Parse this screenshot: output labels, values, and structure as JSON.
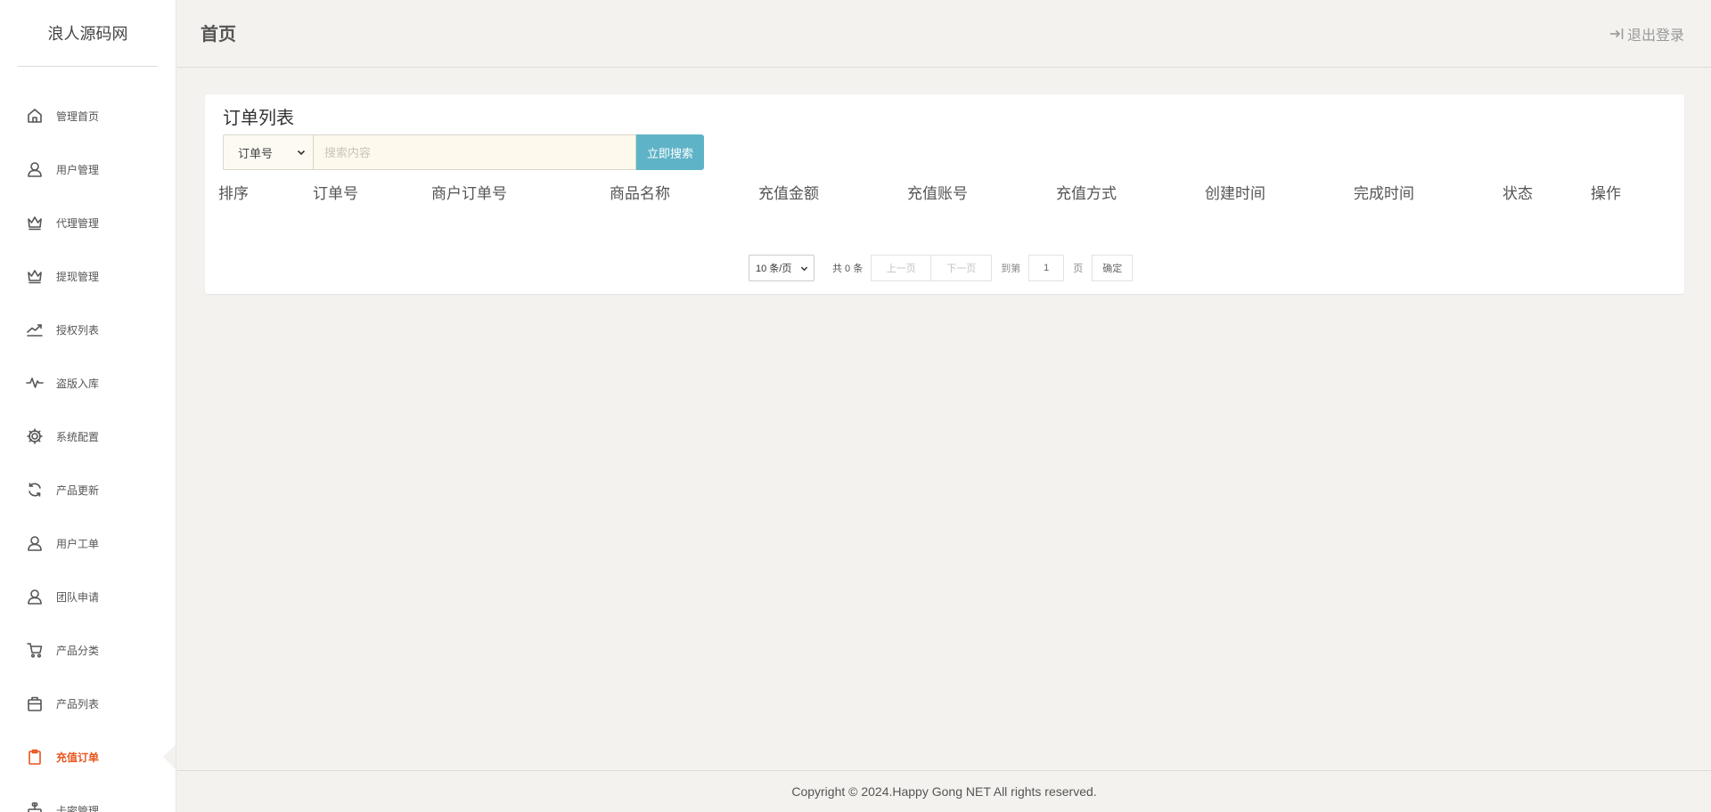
{
  "app": {
    "logo_text": "浪人源码网"
  },
  "sidebar": {
    "items": [
      {
        "label": "管理首页",
        "icon": "home-icon"
      },
      {
        "label": "用户管理",
        "icon": "user-icon"
      },
      {
        "label": "代理管理",
        "icon": "crown-icon"
      },
      {
        "label": "提现管理",
        "icon": "crown-icon"
      },
      {
        "label": "授权列表",
        "icon": "trend-icon"
      },
      {
        "label": "盗版入库",
        "icon": "pulse-icon"
      },
      {
        "label": "系统配置",
        "icon": "gear-icon"
      },
      {
        "label": "产品更新",
        "icon": "refresh-icon"
      },
      {
        "label": "用户工单",
        "icon": "user-icon"
      },
      {
        "label": "团队申请",
        "icon": "user-icon"
      },
      {
        "label": "产品分类",
        "icon": "cart-icon"
      },
      {
        "label": "产品列表",
        "icon": "bag-icon"
      },
      {
        "label": "充值订单",
        "icon": "clipboard-icon",
        "active": true
      },
      {
        "label": "卡密管理",
        "icon": "stamp-icon"
      }
    ]
  },
  "header": {
    "title": "首页",
    "logout_label": "退出登录"
  },
  "card": {
    "title": "订单列表",
    "search": {
      "field_selected": "订单号",
      "placeholder": "搜索内容",
      "value": "",
      "button_label": "立即搜索"
    },
    "columns": [
      "排序",
      "订单号",
      "商户订单号",
      "商品名称",
      "充值金额",
      "充值账号",
      "充值方式",
      "创建时间",
      "完成时间",
      "状态",
      "操作"
    ],
    "rows": []
  },
  "pagination": {
    "page_size_selected": "10 条/页",
    "total_text": "共 0 条",
    "prev_label": "上一页",
    "next_label": "下一页",
    "goto_label": "到第",
    "page_value": "1",
    "page_suffix": "页",
    "confirm_label": "确定"
  },
  "footer": {
    "copyright": "Copyright © 2024.Happy Gong NET All rights reserved."
  },
  "colors": {
    "accent": "#e8541e",
    "search_button": "#5fb3c7",
    "page_bg": "#f3f2ef"
  }
}
